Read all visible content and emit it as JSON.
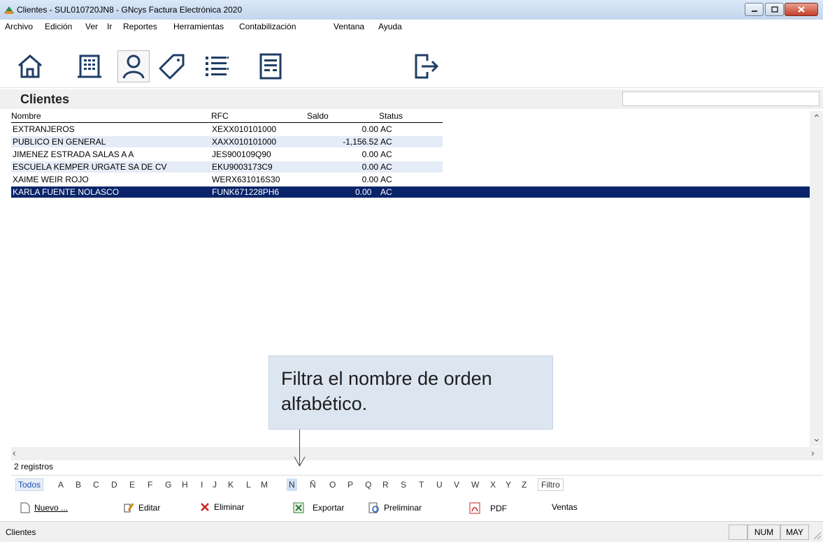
{
  "window": {
    "title": "Clientes - SUL010720JN8 - GNcys Factura Electrónica 2020"
  },
  "menu": [
    "Archivo",
    "Edición",
    "Ver",
    "Ir",
    "Reportes",
    "Herramientas",
    "Contabilización",
    "Ventana",
    "Ayuda"
  ],
  "toolbar": {
    "icons": [
      "home-icon",
      "building-icon",
      "user-icon",
      "tag-icon",
      "list-icon",
      "document-icon",
      "exit-icon"
    ],
    "active": "user-icon"
  },
  "page": {
    "title": "Clientes",
    "search_value": ""
  },
  "table": {
    "headers": [
      "Nombre",
      "RFC",
      "Saldo",
      "Status"
    ],
    "rows": [
      {
        "nombre": "EXTRANJEROS",
        "rfc": "XEXX010101000",
        "saldo": "0.00",
        "status": "AC"
      },
      {
        "nombre": "PUBLICO EN GENERAL",
        "rfc": "XAXX010101000",
        "saldo": "-1,156.52",
        "status": "AC"
      },
      {
        "nombre": "JIMENEZ ESTRADA SALAS A A",
        "rfc": "JES900109Q90",
        "saldo": "0.00",
        "status": "AC"
      },
      {
        "nombre": "ESCUELA KEMPER URGATE SA DE CV",
        "rfc": "EKU9003173C9",
        "saldo": "0.00",
        "status": "AC"
      },
      {
        "nombre": "XAIME WEIR ROJO",
        "rfc": "WERX631016S30",
        "saldo": "0.00",
        "status": "AC"
      },
      {
        "nombre": "KARLA FUENTE NOLASCO",
        "rfc": "FUNK671228PH6",
        "saldo": "0.00",
        "status": "AC"
      }
    ],
    "selected_index": 5
  },
  "callout": {
    "text": "Filtra el nombre de orden alfabético."
  },
  "records": {
    "count_label": "2 registros"
  },
  "letters": [
    "Todos",
    "A",
    "B",
    "C",
    "D",
    "E",
    "F",
    "G",
    "H",
    "I",
    "J",
    "K",
    "L",
    "M",
    "N",
    "Ñ",
    "O",
    "P",
    "Q",
    "R",
    "S",
    "T",
    "U",
    "V",
    "W",
    "X",
    "Y",
    "Z",
    "Filtro"
  ],
  "letters_highlighted": "N",
  "actions": {
    "nuevo": "Nuevo ...",
    "editar": "Editar",
    "eliminar": "Eliminar",
    "exportar": "Exportar",
    "preliminar": "Preliminar",
    "pdf": "PDF",
    "ventas": "Ventas"
  },
  "status": {
    "text": "Clientes",
    "num": "NUM",
    "may": "MAY"
  },
  "colors": {
    "selected_row": "#0a246a",
    "alt_row": "#e4ecf7",
    "callout": "#dce6f1"
  }
}
